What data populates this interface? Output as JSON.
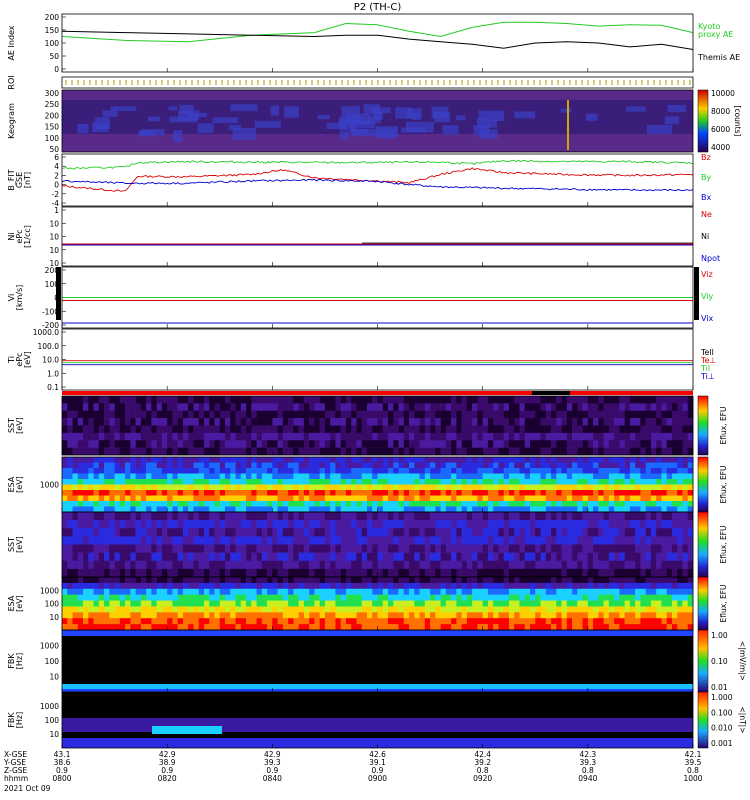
{
  "title": "P2 (TH-C)",
  "date": "2021 Oct 09",
  "chart_data": [
    {
      "type": "line",
      "panel": "ae",
      "ylabel": "AE Index",
      "ylim": [
        0,
        200
      ],
      "yticks": [
        "200",
        "150",
        "100",
        "50",
        "0"
      ],
      "series": [
        {
          "name": "Kyoto proxy AE",
          "color": "#22cc22",
          "x": [
            0,
            0.1,
            0.2,
            0.3,
            0.4,
            0.45,
            0.5,
            0.55,
            0.6,
            0.65,
            0.7,
            0.75,
            0.8,
            0.85,
            0.9,
            0.95,
            1
          ],
          "values": [
            125,
            110,
            105,
            130,
            140,
            175,
            170,
            145,
            125,
            160,
            180,
            180,
            175,
            165,
            170,
            168,
            140
          ]
        },
        {
          "name": "Themis AE",
          "color": "#000000",
          "x": [
            0,
            0.1,
            0.2,
            0.3,
            0.4,
            0.45,
            0.5,
            0.55,
            0.6,
            0.65,
            0.7,
            0.75,
            0.8,
            0.85,
            0.9,
            0.95,
            1
          ],
          "values": [
            145,
            140,
            135,
            130,
            125,
            130,
            130,
            115,
            105,
            95,
            80,
            100,
            105,
            100,
            85,
            95,
            75
          ]
        }
      ]
    },
    {
      "type": "table",
      "panel": "roi",
      "ylabel": "ROI"
    },
    {
      "type": "heatmap",
      "panel": "keogram",
      "ylabel": "Keogram",
      "ylim": [
        0,
        300
      ],
      "yticks": [
        "300",
        "250",
        "200",
        "150",
        "100",
        "50"
      ],
      "colorbar": {
        "ticks": [
          "10000",
          "8000",
          "6000",
          "4000"
        ],
        "label": "[counts]"
      }
    },
    {
      "type": "line",
      "panel": "bfield",
      "ylabel": "B_FIT",
      "ylabel2": "GSE",
      "ylabel3": "[nT]",
      "ylim": [
        -4,
        6
      ],
      "yticks": [
        "6",
        "4",
        "2",
        "0",
        "-2",
        "-4"
      ],
      "series": [
        {
          "name": "Bz",
          "color": "#dd0000",
          "x": [
            0,
            0.1,
            0.12,
            0.2,
            0.3,
            0.35,
            0.4,
            0.5,
            0.55,
            0.6,
            0.65,
            0.7,
            0.8,
            0.9,
            1
          ],
          "values": [
            -0.3,
            -1.5,
            1.8,
            1.7,
            2.2,
            3.2,
            1.5,
            0.8,
            0.4,
            2.2,
            3.5,
            2.6,
            2.2,
            2.0,
            2.2
          ]
        },
        {
          "name": "By",
          "color": "#22cc22",
          "x": [
            0,
            0.1,
            0.12,
            0.2,
            0.3,
            0.4,
            0.5,
            0.6,
            0.65,
            0.7,
            0.8,
            0.9,
            1
          ],
          "values": [
            3.5,
            3.8,
            4.8,
            5.0,
            4.9,
            4.8,
            4.8,
            4.9,
            4.5,
            5.2,
            5.0,
            5.0,
            4.7
          ]
        },
        {
          "name": "Bx",
          "color": "#0000cc",
          "x": [
            0,
            0.1,
            0.2,
            0.3,
            0.4,
            0.5,
            0.55,
            0.6,
            0.7,
            0.8,
            0.9,
            1
          ],
          "values": [
            0.8,
            0.3,
            0.3,
            0.8,
            1.0,
            0.7,
            0.0,
            -0.5,
            -0.8,
            -1.0,
            -1.2,
            -1.2
          ]
        }
      ]
    },
    {
      "type": "line",
      "panel": "density",
      "ylabel": "Ni",
      "ylabel2": "ePc",
      "ylabel3": "[1/cc]",
      "yticks": [
        "1",
        "10",
        "10",
        "10",
        "10"
      ],
      "series": [
        {
          "name": "Ne",
          "color": "#dd0000"
        },
        {
          "name": "Ni",
          "color": "#000000"
        },
        {
          "name": "Npot",
          "color": "#0000cc"
        }
      ]
    },
    {
      "type": "line",
      "panel": "velocity",
      "ylabel": "Vi",
      "ylabel2": "[km/s]",
      "ylim": [
        -300,
        300
      ],
      "yticks": [
        "200",
        "100",
        "0",
        "-100",
        "-200"
      ],
      "series": [
        {
          "name": "Viz",
          "color": "#dd0000"
        },
        {
          "name": "Viy",
          "color": "#22cc22"
        },
        {
          "name": "Vix",
          "color": "#0000cc"
        }
      ]
    },
    {
      "type": "line",
      "panel": "temp",
      "ylabel": "Ti",
      "ylabel2": "ePc",
      "ylabel3": "[eV]",
      "yticks": [
        "1000.0",
        "100.0",
        "10.0",
        "1.0",
        "0.1"
      ],
      "series": [
        {
          "name": "Tell",
          "color": "#000000"
        },
        {
          "name": "Te⊥",
          "color": "#dd0000"
        },
        {
          "name": "Til",
          "color": "#22cc22"
        },
        {
          "name": "Ti⊥",
          "color": "#0000cc"
        }
      ]
    },
    {
      "type": "heatmap",
      "panel": "sst_i",
      "ylabel": "SST",
      "ylabel2": "[eV]",
      "colorbar_label": "Eflux, EFU"
    },
    {
      "type": "heatmap",
      "panel": "esa_i",
      "ylabel": "ESA",
      "ylabel2": "[eV]",
      "yticks": [
        "1000"
      ],
      "colorbar_label": "Eflux, EFU"
    },
    {
      "type": "heatmap",
      "panel": "sst_e",
      "ylabel": "SST",
      "ylabel2": "[eV]",
      "colorbar_label": "Eflux, EFU"
    },
    {
      "type": "heatmap",
      "panel": "esa_e",
      "ylabel": "ESA",
      "ylabel2": "[eV]",
      "yticks": [
        "1000",
        "100",
        "10"
      ],
      "colorbar_label": "Eflux, EFU"
    },
    {
      "type": "heatmap",
      "panel": "fbk_e",
      "ylabel": "FBK",
      "ylabel2": "[Hz]",
      "yticks": [
        "1000",
        "100",
        "10"
      ],
      "colorbar": {
        "ticks": [
          "1.00",
          "0.10",
          "0.01"
        ],
        "label": "<|mV/m|>"
      }
    },
    {
      "type": "heatmap",
      "panel": "fbk_b",
      "ylabel": "FBK",
      "ylabel2": "[Hz]",
      "yticks": [
        "1000",
        "100",
        "10"
      ],
      "colorbar": {
        "ticks": [
          "1.000",
          "0.100",
          "0.010",
          "0.001"
        ],
        "label": "<|nT|>"
      }
    }
  ],
  "axis": {
    "rows": [
      {
        "label": "X-GSE",
        "values": [
          "43.1",
          "42.9",
          "42.9",
          "42.6",
          "42.4",
          "42.3",
          "42.1"
        ]
      },
      {
        "label": "Y-GSE",
        "values": [
          "38.6",
          "38.9",
          "39.3",
          "39.1",
          "39.2",
          "39.3",
          "39.5"
        ]
      },
      {
        "label": "Z-GSE",
        "values": [
          "0.9",
          "0.9",
          "0.9",
          "0.9",
          "0.8",
          "0.8",
          "0.8"
        ]
      },
      {
        "label": "hhmm",
        "values": [
          "0800",
          "0820",
          "0840",
          "0900",
          "0920",
          "0940",
          "1000"
        ]
      }
    ]
  }
}
